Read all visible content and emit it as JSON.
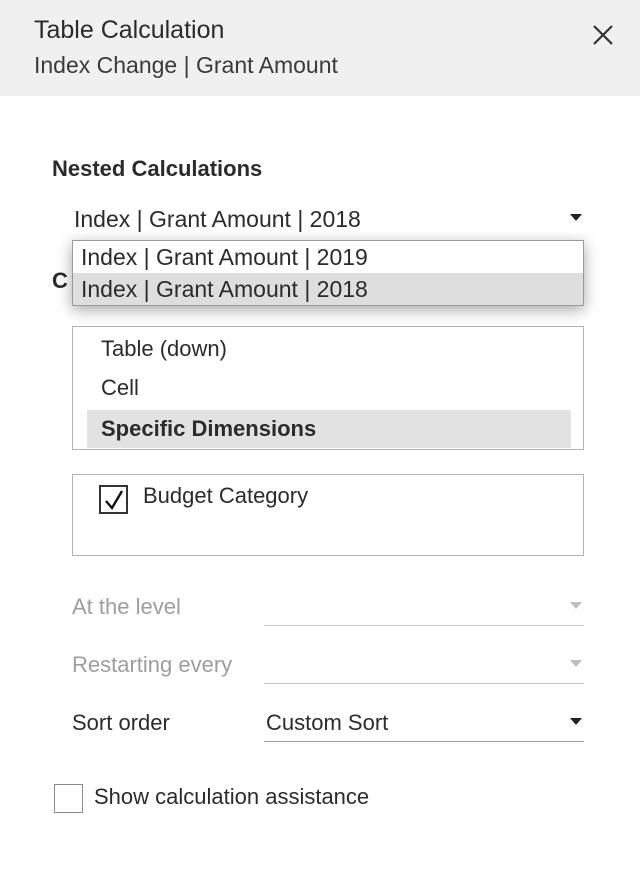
{
  "header": {
    "title": "Table Calculation",
    "subtitle": "Index Change | Grant Amount"
  },
  "nested": {
    "label": "Nested Calculations",
    "selected": "Index | Grant Amount | 2018",
    "options": [
      "Index | Grant Amount | 2019",
      "Index | Grant Amount | 2018"
    ],
    "selected_index": 1
  },
  "compute": {
    "label_visible": "C",
    "items": [
      "Table (down)",
      "Cell",
      "Specific Dimensions"
    ],
    "selected_index": 2
  },
  "dimensions": [
    {
      "label": "Budget Category",
      "checked": true
    }
  ],
  "at_level": {
    "label": "At the level",
    "value": "",
    "disabled": true
  },
  "restarting": {
    "label": "Restarting every",
    "value": "",
    "disabled": true
  },
  "sort_order": {
    "label": "Sort order",
    "value": "Custom Sort",
    "disabled": false
  },
  "assistance": {
    "label": "Show calculation assistance",
    "checked": false
  },
  "icons": {
    "close": "close-icon",
    "check": "checkmark-icon",
    "caret": "caret-down-icon"
  }
}
